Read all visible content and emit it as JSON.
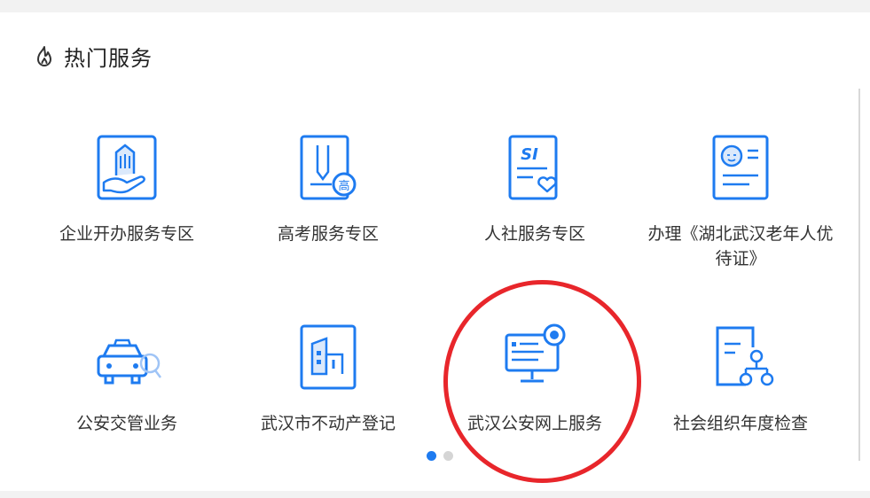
{
  "header": {
    "title": "热门服务",
    "icon": "flame-icon"
  },
  "services": [
    {
      "label": "企业开办服务专区",
      "icon": "building-hand-icon"
    },
    {
      "label": "高考服务专区",
      "icon": "exam-pen-icon"
    },
    {
      "label": "人社服务专区",
      "icon": "social-insurance-icon"
    },
    {
      "label": "办理《湖北武汉老年人优待证》",
      "icon": "senior-card-icon"
    },
    {
      "label": "公安交管业务",
      "icon": "police-car-icon"
    },
    {
      "label": "武汉市不动产登记",
      "icon": "property-building-icon"
    },
    {
      "label": "武汉公安网上服务",
      "icon": "police-computer-icon"
    },
    {
      "label": "社会组织年度检查",
      "icon": "org-chart-icon"
    }
  ],
  "pagination": {
    "pages": 2,
    "current": 1
  },
  "colors": {
    "accent": "#1e7bf0",
    "annotation": "#e8262b"
  }
}
